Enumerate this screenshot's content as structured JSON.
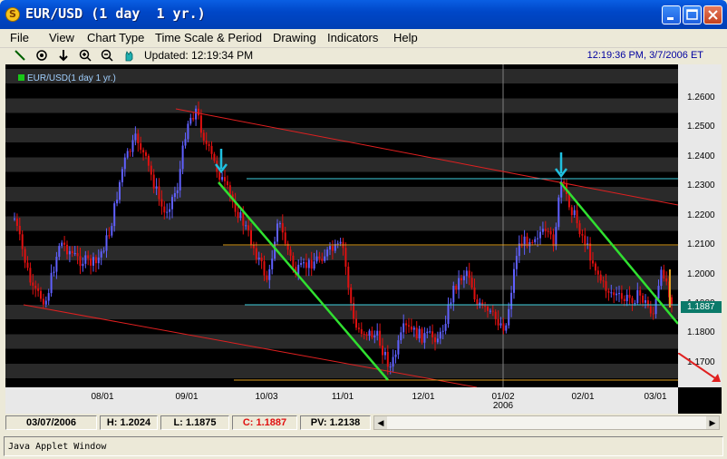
{
  "window": {
    "title": "EUR/USD (1 day  1 yr.)",
    "app_icon": "S",
    "buttons": [
      "minimize",
      "maximize",
      "close"
    ]
  },
  "menu": [
    "File",
    "View",
    "Chart Type",
    "Time Scale & Period",
    "Drawing",
    "Indicators",
    "Help"
  ],
  "toolbar": {
    "tools": [
      "draw-line-icon",
      "target-icon",
      "down-arrow-icon",
      "zoom-in-icon",
      "zoom-out-icon",
      "hand-icon"
    ],
    "updated": "Updated: 12:19:34 PM",
    "clock": "12:19:36 PM, 3/7/2006 ET"
  },
  "chart": {
    "legend": "EUR/USD(1 day  1 yr.)",
    "legend_color": "#18C818",
    "y_ticks": [
      "1.2600",
      "1.2500",
      "1.2400",
      "1.2300",
      "1.2200",
      "1.2100",
      "1.2000",
      "1.1900",
      "1.1800",
      "1.1700"
    ],
    "current_price": "1.1887",
    "x_ticks": [
      "08/01",
      "09/01",
      "10/03",
      "11/01",
      "12/01",
      "01/02",
      "02/01",
      "03/01"
    ],
    "x_year": "2006",
    "colors": {
      "up": "#6060FF",
      "down": "#E01010",
      "trend_red": "#E02020",
      "trend_green": "#30E030",
      "hline_orange": "#E0A020",
      "hline_cyan": "#40D0E0",
      "arrow_cyan": "#20C0E0"
    }
  },
  "status": {
    "date": "03/07/2006",
    "high": "H: 1.2024",
    "low": "L: 1.1875",
    "close": "C: 1.1887",
    "pv": "PV: 1.2138"
  },
  "applet": "Java Applet Window"
}
